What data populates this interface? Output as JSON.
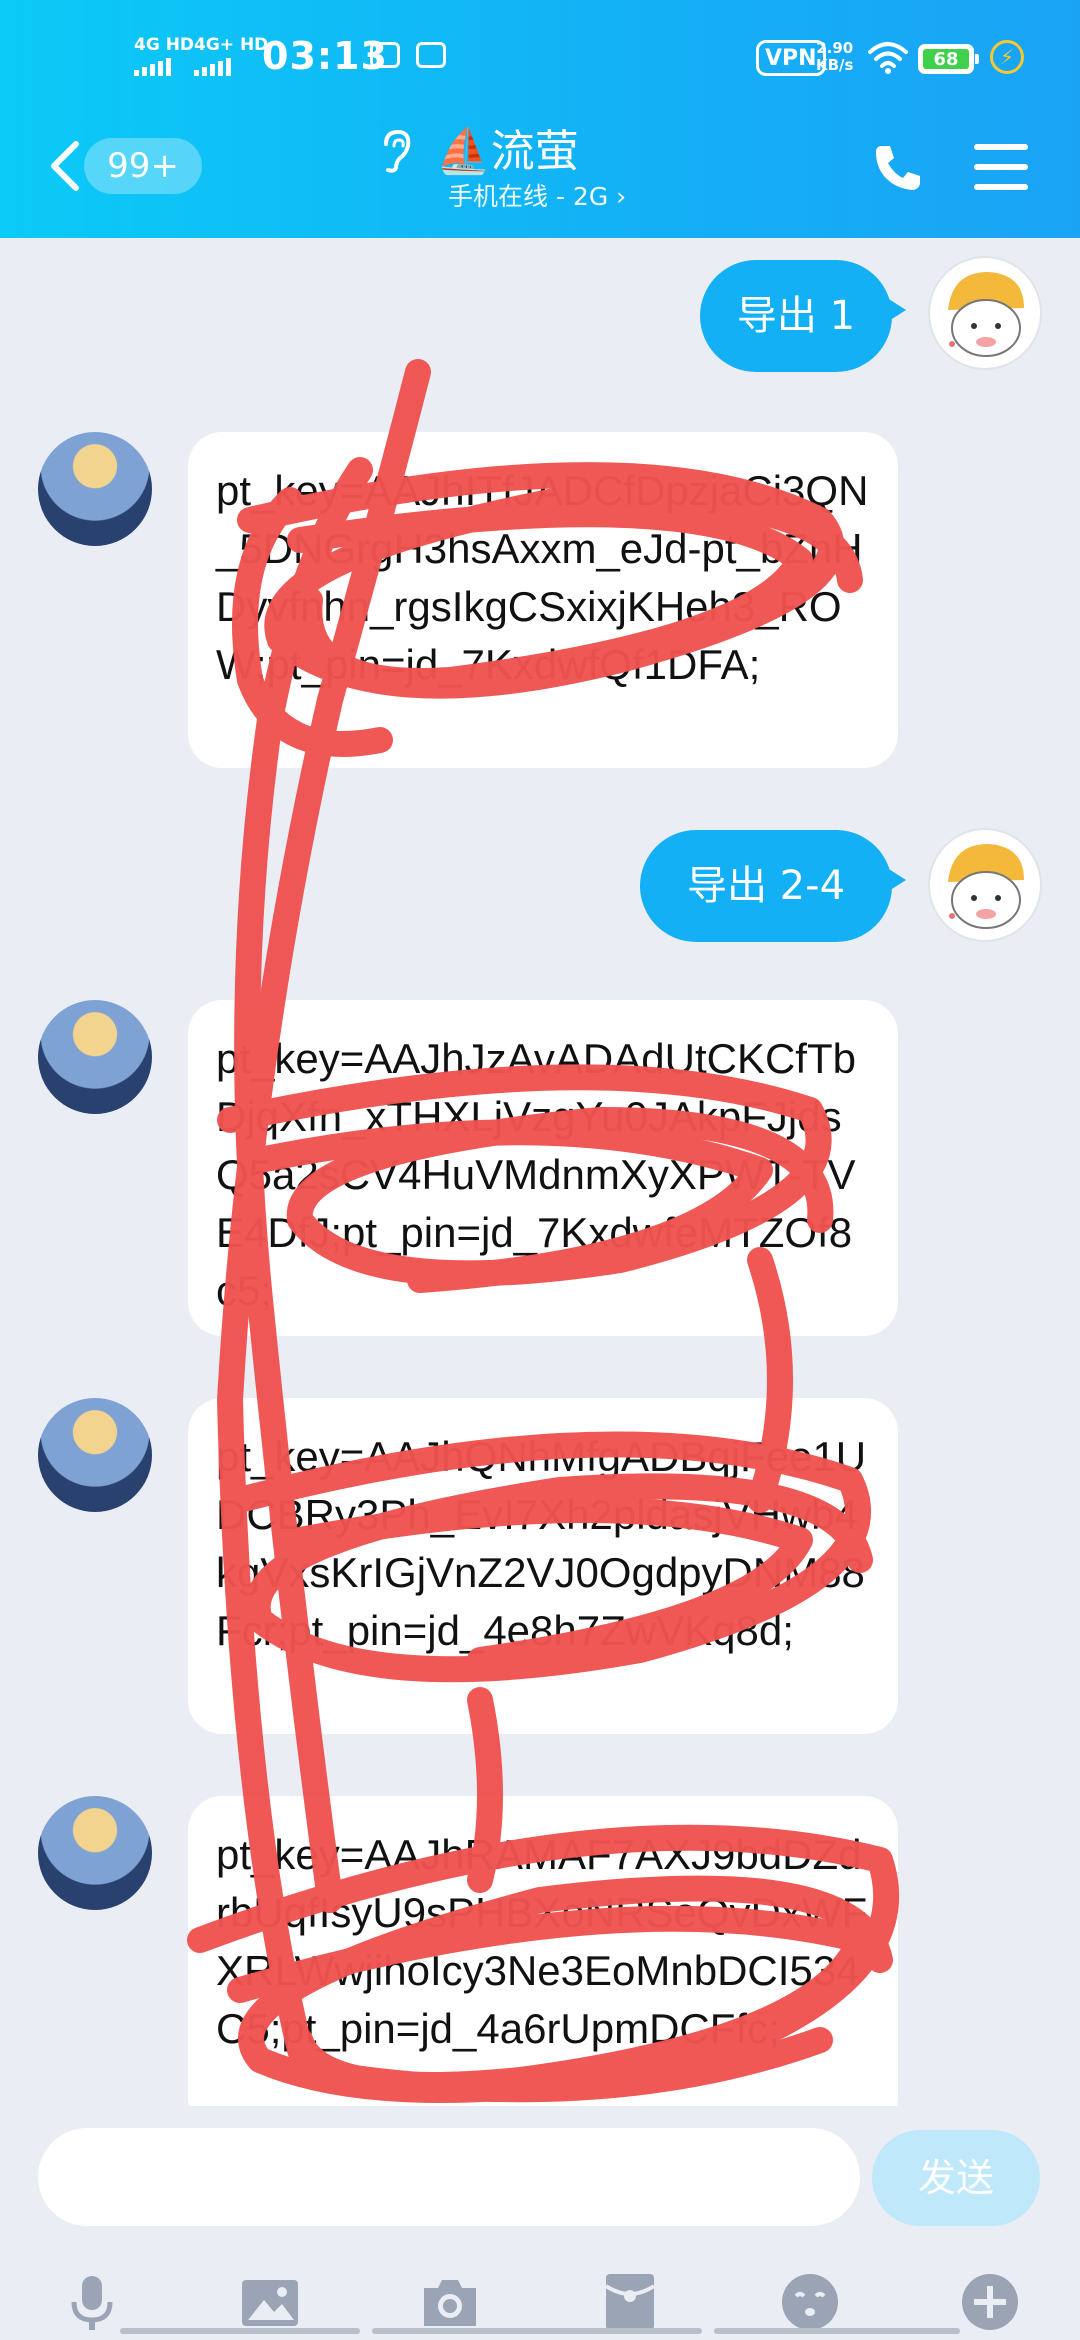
{
  "status_bar": {
    "signal_1": "4G HD",
    "signal_2": "4G+ HD",
    "time": "03:13",
    "vpn": "VPN",
    "speed_value": "2.90",
    "speed_unit": "KB/s",
    "battery": "68"
  },
  "header": {
    "unread_badge": "99+",
    "contact_emoji": "⛵",
    "contact_name": "流萤",
    "status": "手机在线 - 2G ›"
  },
  "messages": [
    {
      "direction": "out",
      "text": "导出 1"
    },
    {
      "direction": "in",
      "text": "pt_key=AAJhITfJADCfDpzjaCi3QN_5DNGrgH3hsAxxm_eJd-pt_bZnHDyvfnhn_rgsIkgCSxixjKHeh3_ROW;pt_pin=jd_7KxdwfQf1DFA;"
    },
    {
      "direction": "out",
      "text": "导出 2-4"
    },
    {
      "direction": "in",
      "text": "pt_key=AAJhJzAvADAdUtCKCfTbDjqXfn_xTHXLjVzgYu0JAkpFJjdsQ5a2sCV4HuVMdnmXyXPWT-TVE4DfJ;pt_pin=jd_7KxdwfeMTZOf8c5;"
    },
    {
      "direction": "in",
      "text": "pt_key=AAJhQNhMfgADBqjFee1UDCBRy3Ph_EvI7Xh2pldasjVHwb4kgVxsKrIGjVnZ2VJ0OgdpyDNM88Fcr;pt_pin=jd_4e8h7ZwVKq8d;"
    },
    {
      "direction": "in",
      "text": "pt_key=AAJhRAMAF7AXJ9bdDZdrbUqfIsyU9sPHBXoNRSeQvDxWFXRLWwjihoIcy3Ne3EoMnbDCI534C5;pt_pin=jd_4a6rUpmDCFfc;"
    }
  ],
  "input": {
    "placeholder": "",
    "send_label": "发送"
  },
  "toolbar": [
    "mic-icon",
    "image-icon",
    "camera-icon",
    "red-packet-icon",
    "emoji-icon",
    "plus-icon"
  ],
  "colors": {
    "header_start": "#0bcaf7",
    "header_end": "#1aa3f5",
    "bubble_out": "#13b0f5",
    "bubble_in": "#ffffff",
    "background": "#eaedf4",
    "scribble": "#ef5350",
    "battery": "#3fd14b"
  }
}
